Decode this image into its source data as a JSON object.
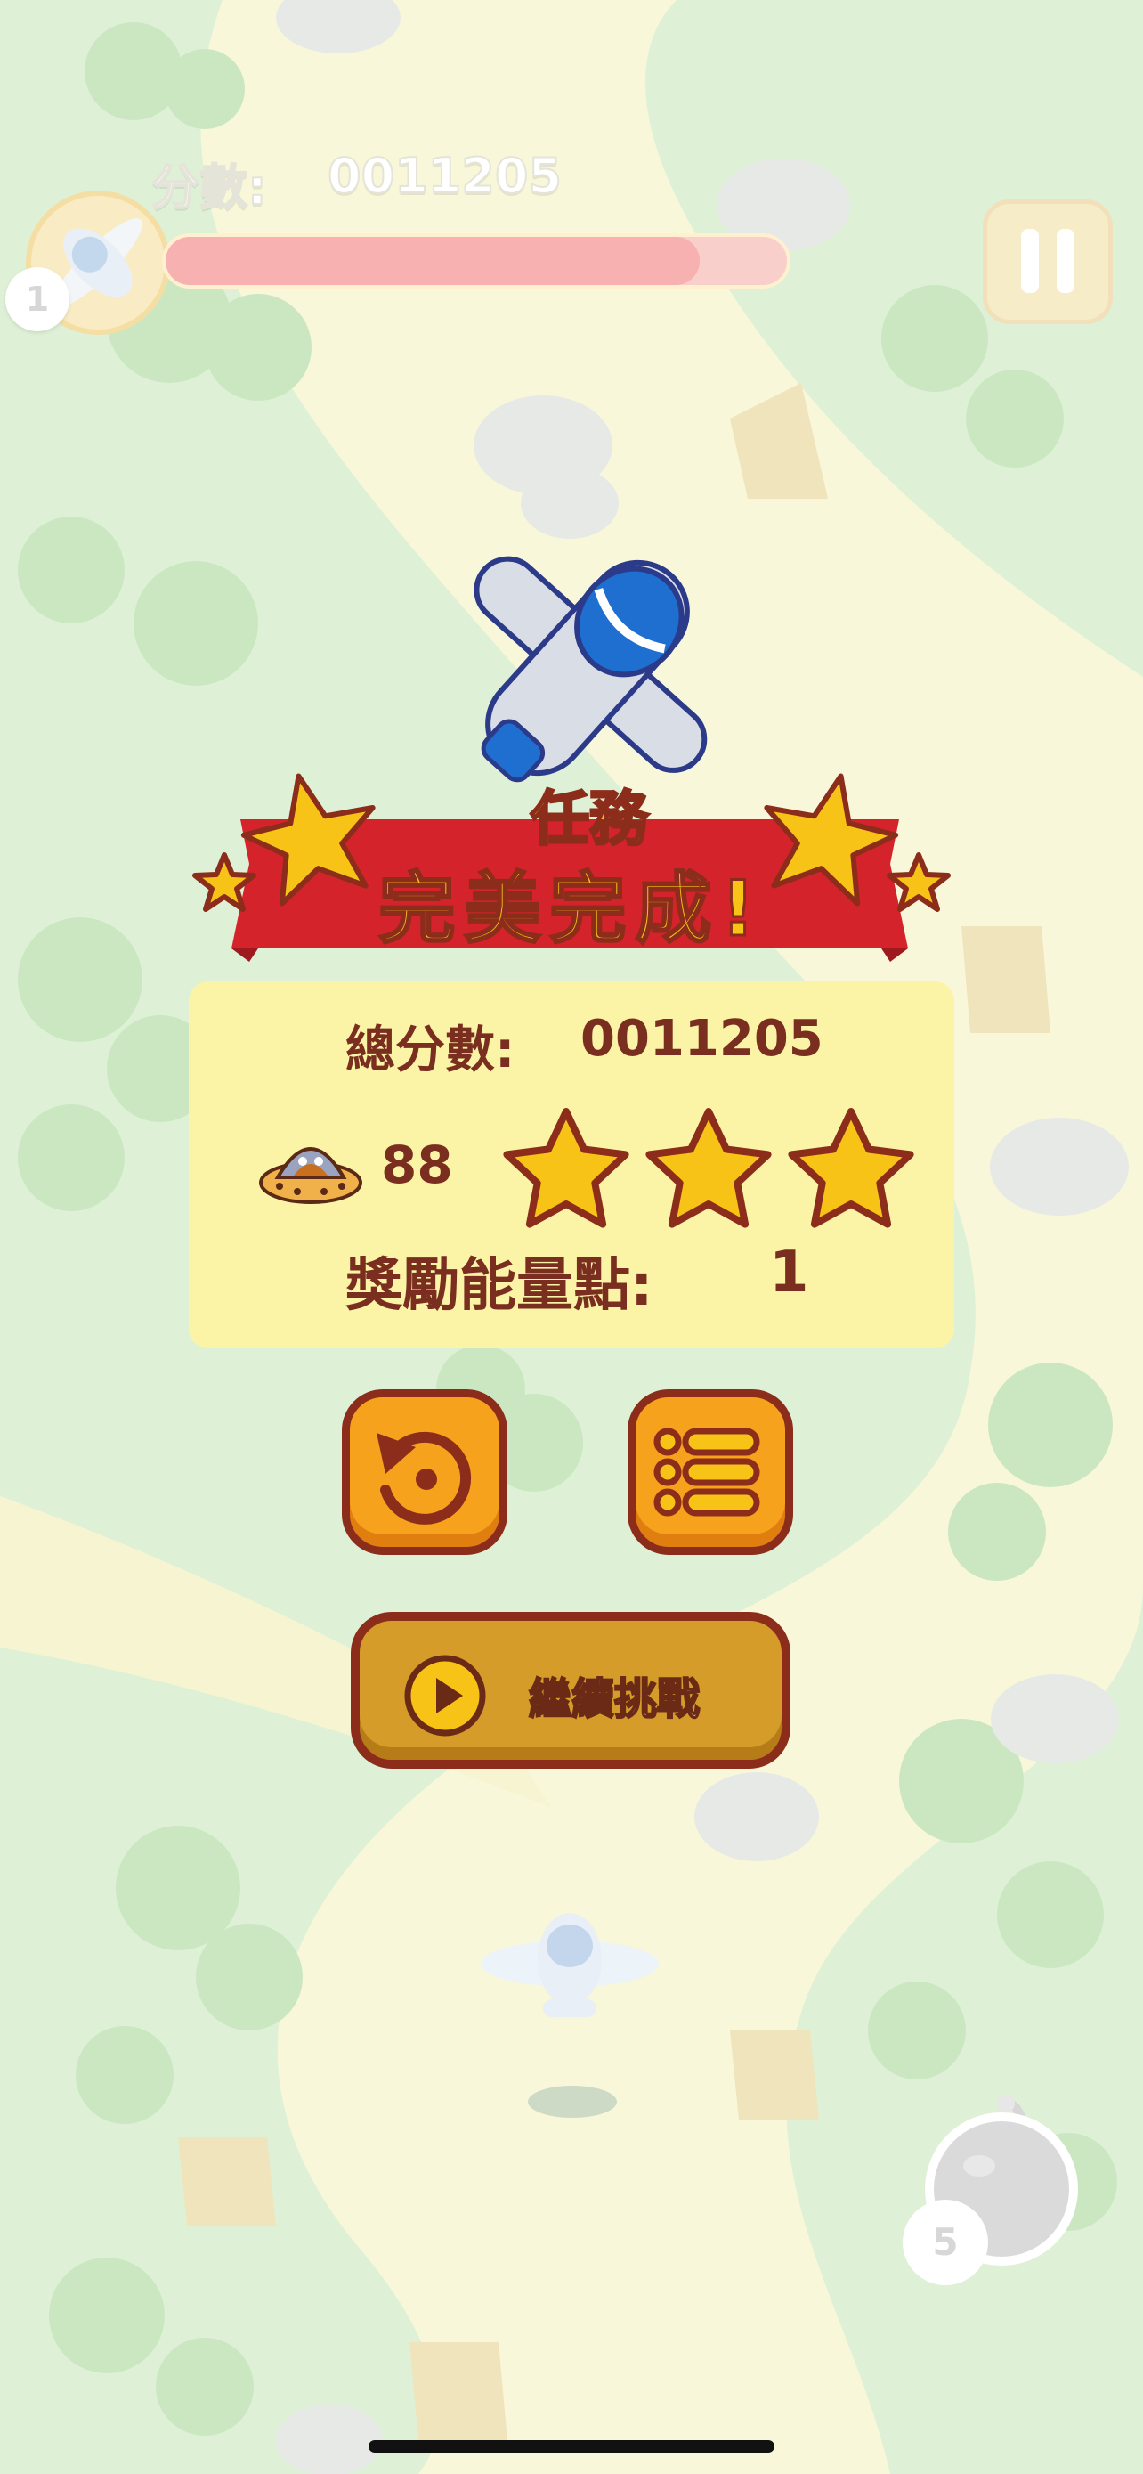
{
  "hud": {
    "score_label": "分數:",
    "score_value": "0011205",
    "lives": "1",
    "progress": 0.86,
    "bombs": "5",
    "pause_icon": "pause-icon",
    "avatar_icon": "plane-icon"
  },
  "result": {
    "banner_line1": "任務",
    "banner_line2": "完美完成!",
    "total_score_label": "總分數:",
    "total_score_value": "0011205",
    "ufo_icon": "ufo-icon",
    "ufo_count": "88",
    "stars_earned": 3,
    "stars_total": 3,
    "reward_label": "獎勵能量點:",
    "reward_value": "1"
  },
  "buttons": {
    "retry_icon": "retry-icon",
    "menu_icon": "menu-list-icon",
    "continue_icon": "play-icon",
    "continue_label": "繼續挑戰"
  },
  "colors": {
    "banner_red": "#d4232a",
    "star_yellow": "#f7c316",
    "panel_bg": "#fbf4a6",
    "button_orange": "#f7a21d",
    "button_border": "#8c2d1b"
  }
}
